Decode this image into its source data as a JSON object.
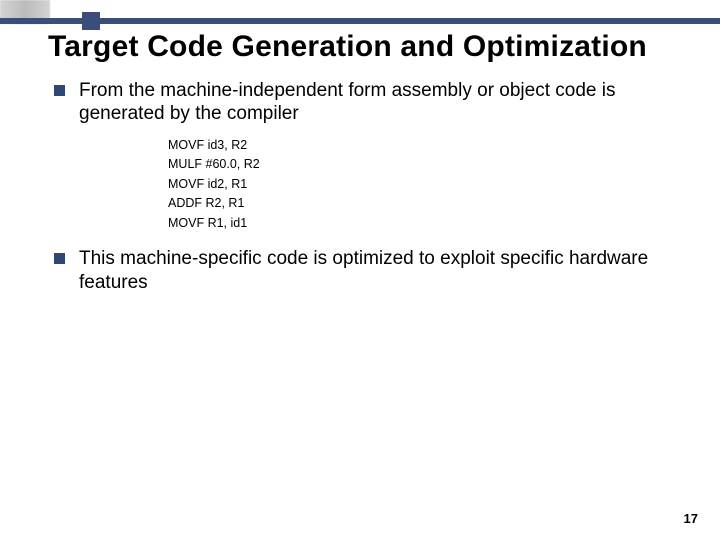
{
  "title": "Target Code Generation and Optimization",
  "bullets": [
    {
      "text": "From the machine-independent form assembly or object code is generated by the compiler"
    },
    {
      "text": "This machine-specific code is optimized to exploit specific hardware features"
    }
  ],
  "code": [
    "MOVF id3, R2",
    "MULF #60.0, R2",
    "MOVF id2, R1",
    "ADDF R2, R1",
    "MOVF R1, id1"
  ],
  "page_number": "17"
}
